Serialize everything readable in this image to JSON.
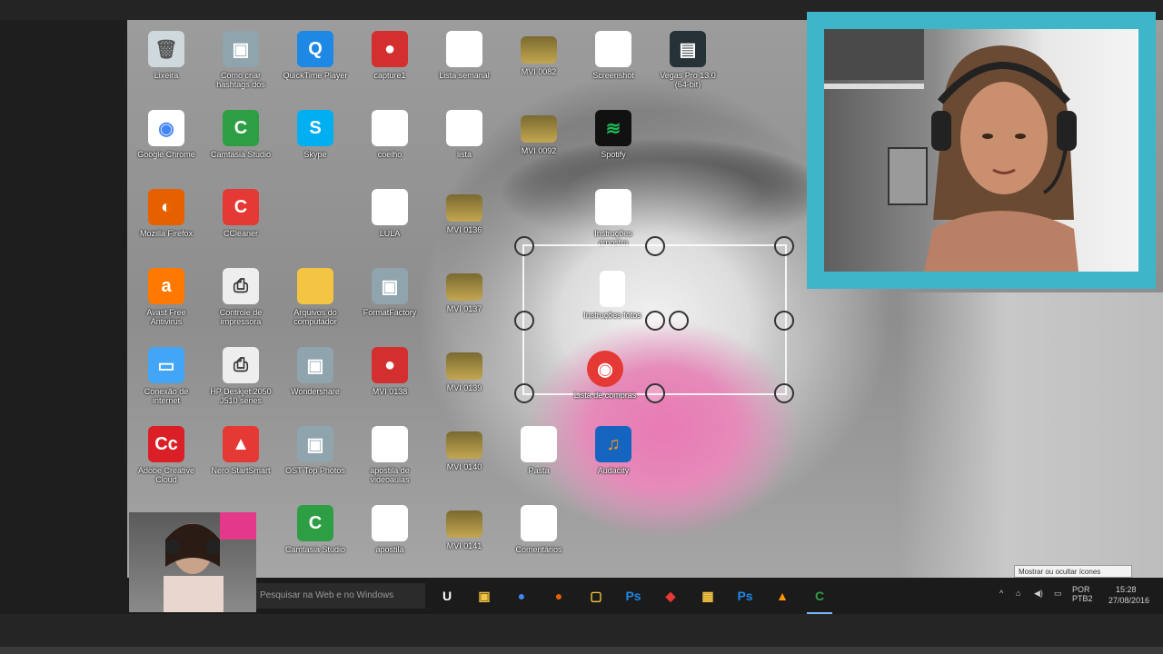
{
  "desktop": {
    "icons": [
      {
        "label": "Lixeira",
        "kind": "recycle"
      },
      {
        "label": "Como criar hashtags dos",
        "kind": "app"
      },
      {
        "label": "QuickTime Player",
        "kind": "quicktime"
      },
      {
        "label": "capture1",
        "kind": "red"
      },
      {
        "label": "Lista semanal",
        "kind": "doc"
      },
      {
        "label": "MVI 0082",
        "kind": "video"
      },
      {
        "label": "Screenshot",
        "kind": "doc"
      },
      {
        "label": "Vegas Pro 13.0 (64-bit)",
        "kind": "film"
      },
      {
        "label": "Google Chrome",
        "kind": "chrome"
      },
      {
        "label": "Camtasia Studio",
        "kind": "camtasia"
      },
      {
        "label": "Skype",
        "kind": "skype"
      },
      {
        "label": "coelho",
        "kind": "doc"
      },
      {
        "label": "lista",
        "kind": "doc"
      },
      {
        "label": "MVI 0092",
        "kind": "video"
      },
      {
        "label": "Spotify",
        "kind": "spotify"
      },
      {
        "label": "Mozilla Firefox",
        "kind": "firefox"
      },
      {
        "label": "CCleaner",
        "kind": "ccleaner"
      },
      {
        "label": "LULA",
        "kind": "doc"
      },
      {
        "label": "MVI 0136",
        "kind": "video"
      },
      {
        "label": "Instruções amostra",
        "kind": "doc"
      },
      {
        "label": "Avast Free Antivirus",
        "kind": "avast"
      },
      {
        "label": "Controle de impressora",
        "kind": "printer"
      },
      {
        "label": "Arquivos do computador",
        "kind": "folder"
      },
      {
        "label": "FormatFactory",
        "kind": "app"
      },
      {
        "label": "MVI 0137",
        "kind": "video"
      },
      {
        "label": "Conexão de internet",
        "kind": "pc"
      },
      {
        "label": "HP Deskjet 2050 J510 series",
        "kind": "printer"
      },
      {
        "label": "Wondershare",
        "kind": "app"
      },
      {
        "label": "MVI 0138",
        "kind": "red"
      },
      {
        "label": "MVI 0139",
        "kind": "video"
      },
      {
        "label": "Adobe Creative Cloud",
        "kind": "adobe"
      },
      {
        "label": "Nero StartSmart",
        "kind": "nero"
      },
      {
        "label": "OST Top Photos",
        "kind": "app"
      },
      {
        "label": "apostila de videoaulas",
        "kind": "doc"
      },
      {
        "label": "MVI 0140",
        "kind": "video"
      },
      {
        "label": "Pasta",
        "kind": "doc"
      },
      {
        "label": "Audacity",
        "kind": "audacity"
      },
      {
        "label": "Camtasia Studio",
        "kind": "camtasia"
      },
      {
        "label": "apostila",
        "kind": "doc"
      },
      {
        "label": "MVI 0141",
        "kind": "video"
      },
      {
        "label": "Comentários",
        "kind": "doc"
      }
    ],
    "selected_icons": [
      {
        "label": "Instruções fotos"
      },
      {
        "label": "Lista de compras"
      }
    ]
  },
  "taskbar": {
    "search_placeholder": "Pesquisar na Web e no Windows",
    "apps": [
      "U",
      "▣",
      "●",
      "●",
      "▢",
      "Ps",
      "◆",
      "▦",
      "Ps",
      "▲",
      "C"
    ],
    "tray_time": "15:28",
    "tray_date": "27/08/2016",
    "tray_lang": "POR PTB2"
  },
  "notification": {
    "text": "Mostrar ou ocultar ícones"
  },
  "colors": {
    "webcam_border": "#3fb5c9",
    "taskbar": "#1b1b1b",
    "flower": "#e97ab5"
  }
}
